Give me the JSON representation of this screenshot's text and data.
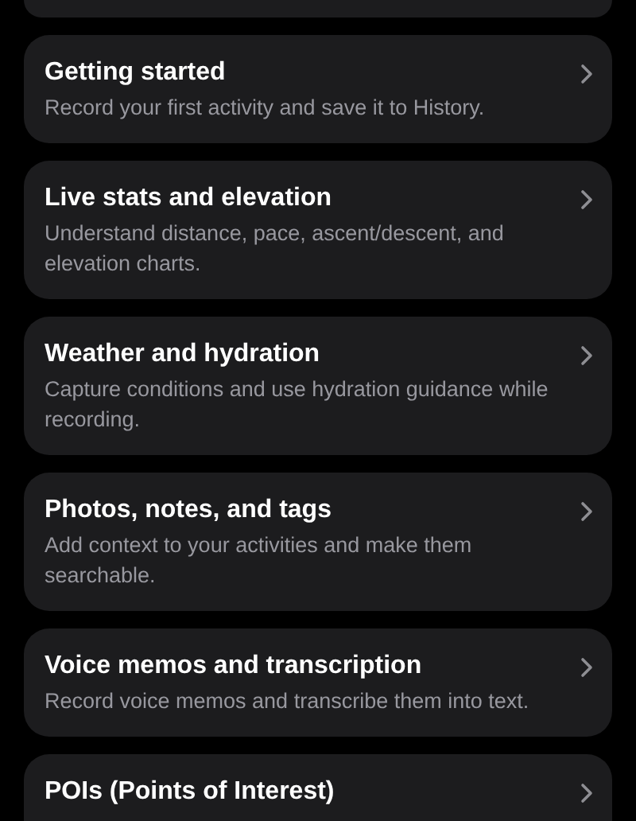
{
  "cards": [
    {
      "title": "Getting started",
      "description": "Record your first activity and save it to History."
    },
    {
      "title": "Live stats and elevation",
      "description": "Understand distance, pace, ascent/descent, and elevation charts."
    },
    {
      "title": "Weather and hydration",
      "description": "Capture conditions and use hydration guidance while recording."
    },
    {
      "title": "Photos, notes, and tags",
      "description": "Add context to your activities and make them searchable."
    },
    {
      "title": "Voice memos and transcription",
      "description": "Record voice memos and transcribe them into text."
    },
    {
      "title": "POIs (Points of Interest)"
    }
  ]
}
